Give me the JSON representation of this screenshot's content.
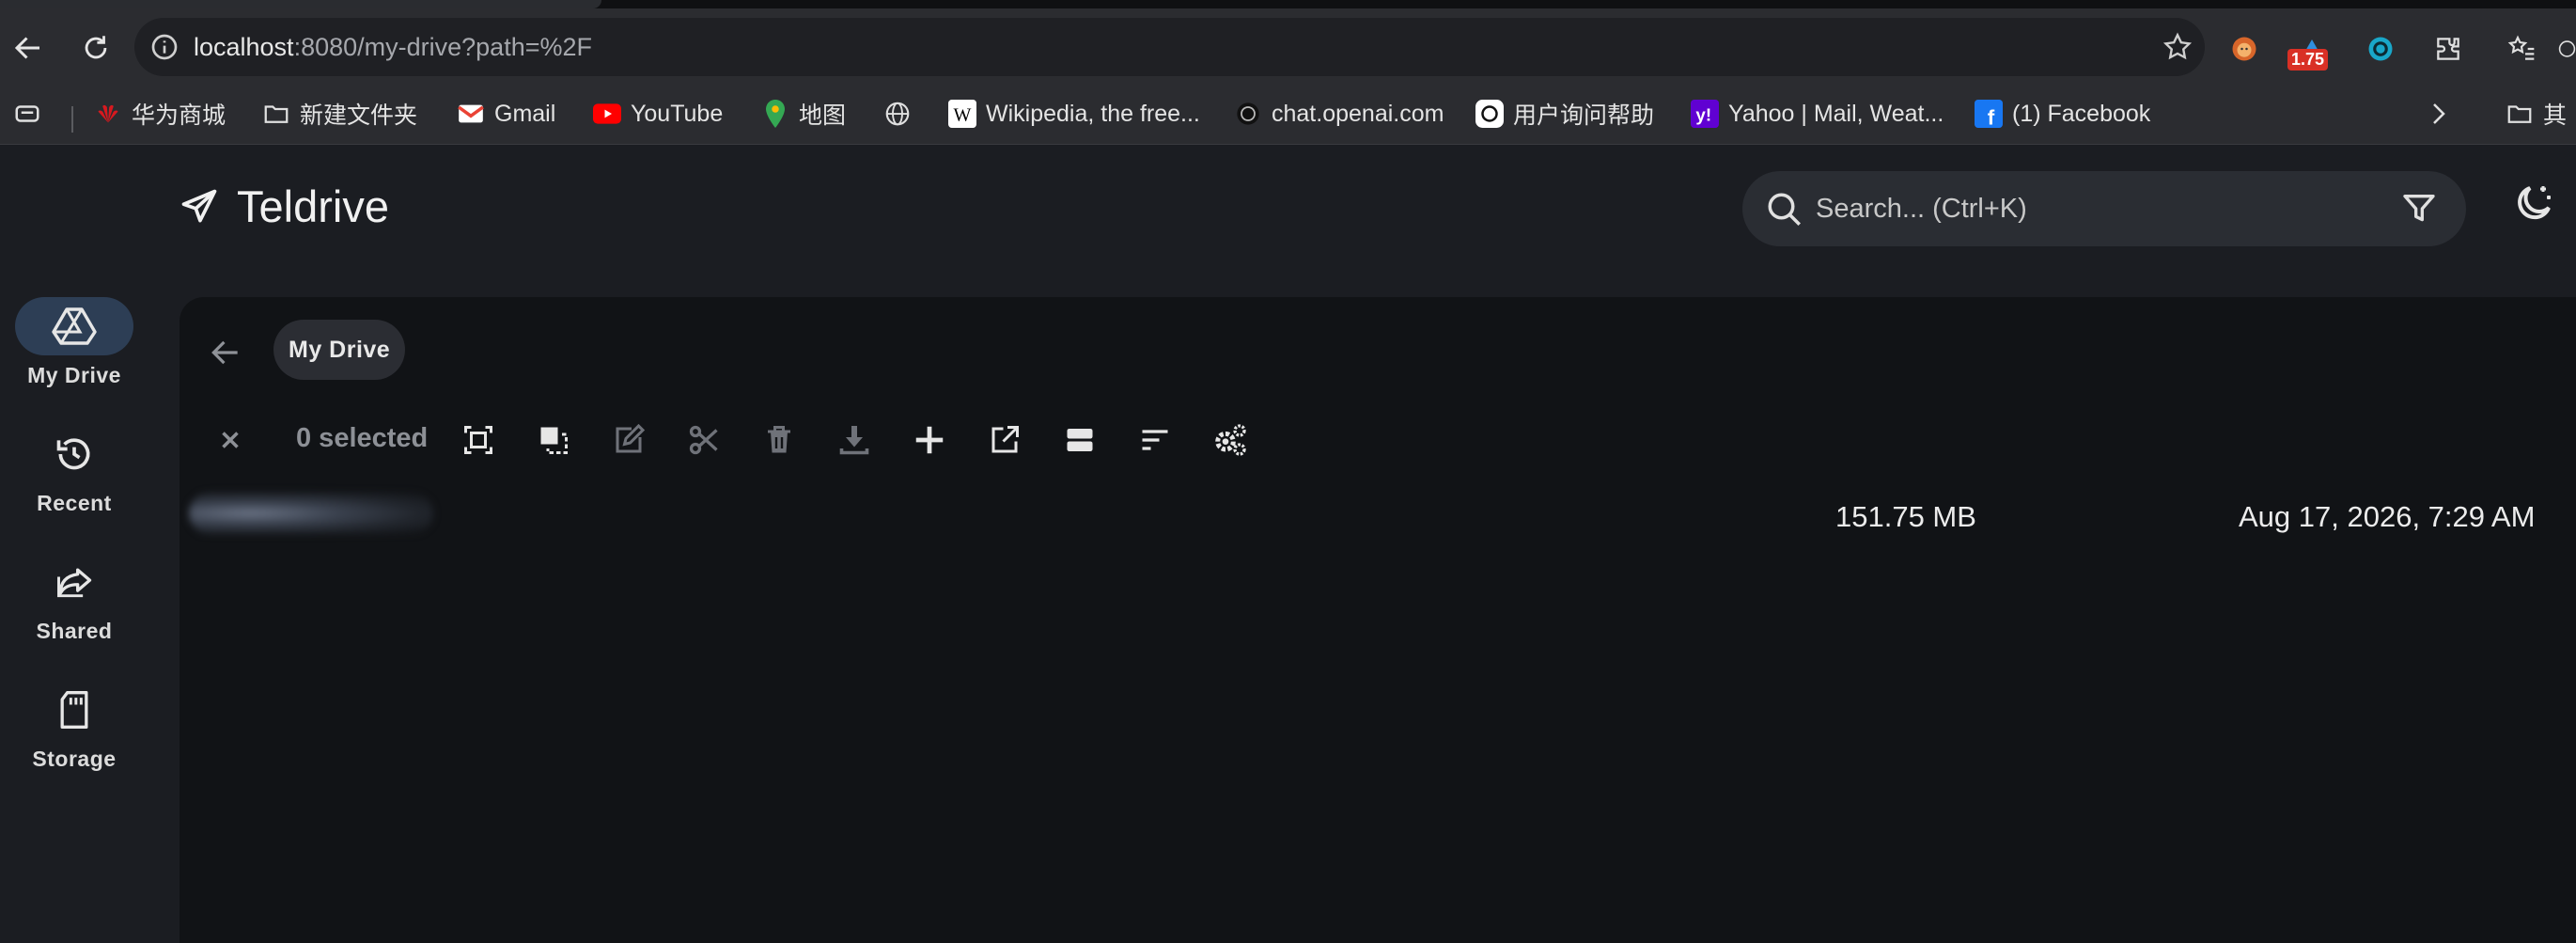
{
  "browser": {
    "url_host": "localhost",
    "url_rest": ":8080/my-drive?path=%2F",
    "extension_badge": "1.75",
    "bookmarks": [
      {
        "label": "华为商城",
        "icon": "huawei-icon"
      },
      {
        "label": "新建文件夹",
        "icon": "folder-icon"
      },
      {
        "label": "Gmail",
        "icon": "gmail-icon"
      },
      {
        "label": "YouTube",
        "icon": "youtube-icon"
      },
      {
        "label": "地图",
        "icon": "maps-pin-icon"
      },
      {
        "label": "",
        "icon": "globe-icon"
      },
      {
        "label": "Wikipedia, the free...",
        "icon": "wikipedia-icon"
      },
      {
        "label": "chat.openai.com",
        "icon": "openai-icon"
      },
      {
        "label": "用户询问帮助",
        "icon": "chatgpt-icon"
      },
      {
        "label": "Yahoo | Mail, Weat...",
        "icon": "yahoo-icon"
      },
      {
        "label": "(1) Facebook",
        "icon": "facebook-icon"
      }
    ],
    "other_bookmarks": "其"
  },
  "app": {
    "name": "Teldrive",
    "search_placeholder": "Search... (Ctrl+K)"
  },
  "nav": [
    {
      "label": "My Drive",
      "icon": "drive-icon",
      "active": true
    },
    {
      "label": "Recent",
      "icon": "history-icon",
      "active": false
    },
    {
      "label": "Shared",
      "icon": "share-icon",
      "active": false
    },
    {
      "label": "Storage",
      "icon": "sd-card-icon",
      "active": false
    }
  ],
  "breadcrumb": {
    "current": "My Drive"
  },
  "toolbar": {
    "selected_text": "0 selected",
    "actions": [
      "select-all-icon",
      "select-invert-icon",
      "rename-icon",
      "cut-icon",
      "delete-icon",
      "download-icon",
      "add-icon",
      "open-external-icon",
      "view-toggle-icon",
      "sort-icon",
      "settings-icon"
    ]
  },
  "files": [
    {
      "name": "",
      "size": "151.75 MB",
      "modified": "Aug 17, 2026, 7:29 AM"
    }
  ],
  "colors": {
    "active_nav": "#2d3e55",
    "content_bg": "#111316",
    "app_bg": "#1b1d22"
  }
}
